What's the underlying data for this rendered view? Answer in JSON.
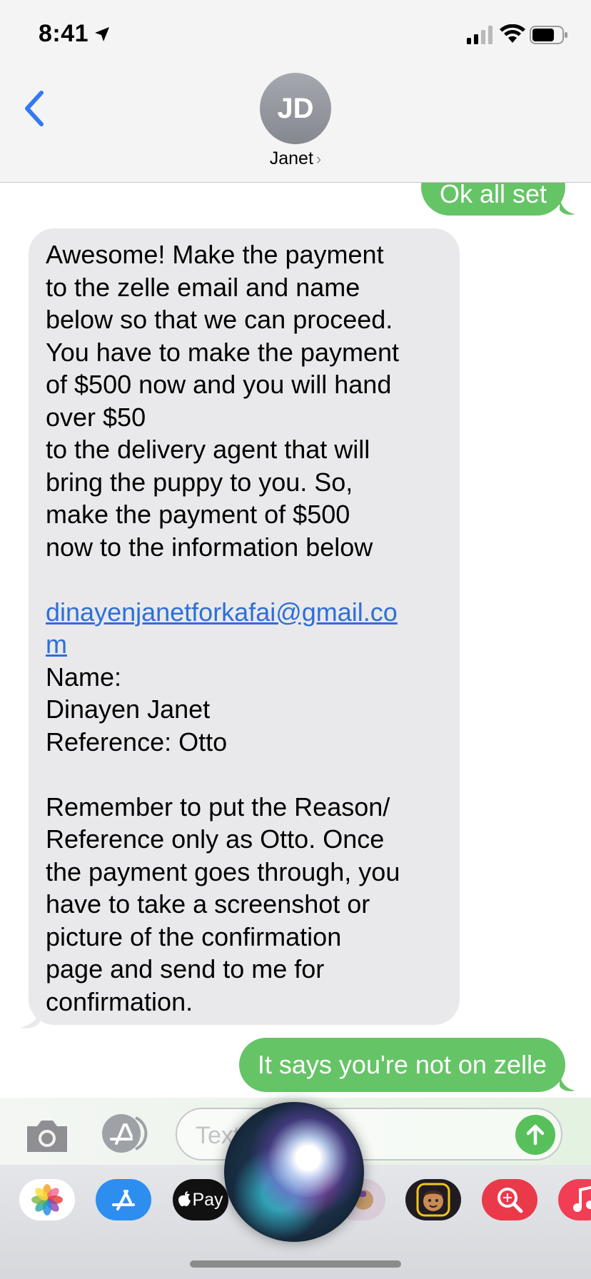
{
  "status_bar": {
    "time": "8:41"
  },
  "header": {
    "contact_initials": "JD",
    "contact_name": "Janet",
    "chevron": "›"
  },
  "messages": {
    "sent_1": "Ok all set",
    "received_lines_1": [
      "Awesome! Make the payment",
      "to the zelle email and name",
      "below so that we can proceed.",
      "You have to make the payment",
      "of $500 now and you will hand",
      "over $50",
      "to the delivery agent that will",
      "bring the puppy to you. So,",
      "make the payment of $500",
      "now to the information below"
    ],
    "email_line_1": "dinayenjanetforkafai@gmail.co",
    "email_line_2": "m",
    "received_lines_2": [
      "Name:",
      "Dinayen Janet",
      "Reference: Otto"
    ],
    "received_lines_3": [
      "Remember to put the Reason/",
      "Reference only as Otto. Once",
      "the payment goes through, you",
      "have to take a screenshot or",
      "picture of the confirmation",
      "page and send to me for",
      "confirmation."
    ],
    "sent_2": "It says you're not on zelle"
  },
  "input": {
    "placeholder": "Text Message"
  },
  "app_drawer": {
    "apple_pay_label": "Pay",
    "icons": [
      "photos-icon",
      "app-store-icon",
      "apple-pay-icon",
      "memoji-icon",
      "image-search-icon",
      "music-icon"
    ]
  },
  "colors": {
    "sent_bubble": "#65c466",
    "received_bubble": "#e9e9eb",
    "link": "#2e6fd9",
    "ios_blue": "#3478f6"
  }
}
